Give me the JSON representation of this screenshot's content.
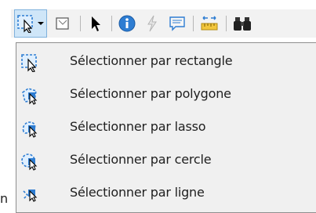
{
  "menu": {
    "items": [
      {
        "label": "Sélectionner par rectangle",
        "icon": "select-rectangle-icon"
      },
      {
        "label": "Sélectionner par polygone",
        "icon": "select-polygon-icon"
      },
      {
        "label": "Sélectionner par lasso",
        "icon": "select-lasso-icon"
      },
      {
        "label": "Sélectionner par cercle",
        "icon": "select-circle-icon"
      },
      {
        "label": "Sélectionner par ligne",
        "icon": "select-line-icon"
      }
    ]
  },
  "background_text": "n",
  "colors": {
    "accent": "#2e7dd2",
    "menu_bg": "#f0f0f0",
    "active_bg": "#cfe6f8"
  }
}
